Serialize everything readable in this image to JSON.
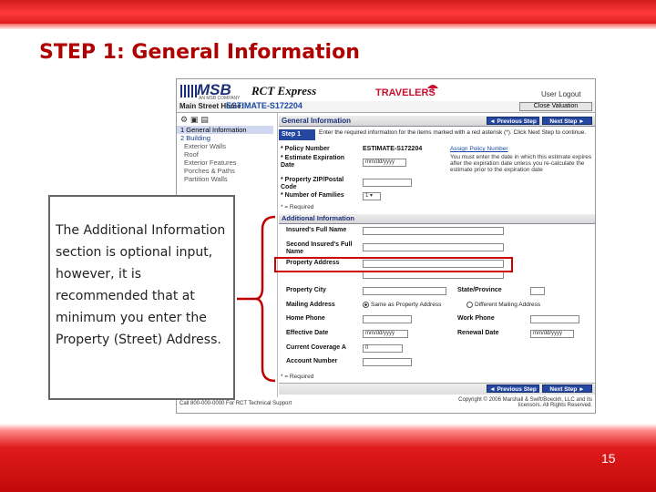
{
  "slide": {
    "title": "STEP 1:  General Information",
    "page_number": "15"
  },
  "app": {
    "msb_logo": "MSB",
    "msb_sub": "AN MSB COMPANY",
    "product": "RCT Express",
    "partner": "TRAVELERS",
    "logout": "User  Logout",
    "home_label": "Main Street Home:",
    "estimate_id": "ESTIMATE-S172204",
    "close_button": "Close Valuation"
  },
  "nav": {
    "items": [
      "1 General Information",
      "2 Building",
      "Exterior Walls",
      "Roof",
      "Exterior Features",
      "Porches & Paths",
      "Partition Walls"
    ]
  },
  "form": {
    "section_title": "General Information",
    "prev_button": "Previous Step",
    "next_button": "Next Step",
    "step_tag": "Step 1",
    "instructions": "Enter the required information for the items marked with a red asterisk (*). Click Next Step to continue.",
    "policy_label": "* Policy Number",
    "policy_value": "ESTIMATE-S172204",
    "assign_link": "Assign Policy Number",
    "expiry_label": "* Estimate Expiration Date",
    "date_placeholder": "mm/dd/yyyy",
    "expiry_note": "You must enter the date in which this estimate expires after the expiration date unless you re-calculate the estimate prior to the expiration date",
    "zip_label": "* Property ZIP/Postal Code",
    "families_label": "* Number of Families",
    "families_value": "1",
    "required_note": "* = Required",
    "addl_title": "Additional Information",
    "insured_name": "Insured's Full Name",
    "second_insured": "Second Insured's Full Name",
    "property_address": "Property Address",
    "property_city": "Property City",
    "state": "State/Province",
    "mailing_address": "Mailing Address",
    "same_as_property": "Same as Property Address",
    "different_mailing": "Different Mailing Address",
    "home_phone": "Home Phone",
    "work_phone": "Work Phone",
    "effective_date": "Effective Date",
    "renewal_date": "Renewal Date",
    "current_coverage": "Current Coverage A",
    "coverage_value": "0",
    "account_number": "Account Number",
    "required_note2": "* = Required",
    "prev_button2": "Previous Step",
    "next_button2": "Next Step"
  },
  "shot_footer": {
    "left": "Call 800-000-0000 For RCT Technical Support",
    "right": "Copyright © 2006 Marshall & Swift/Boeckh, LLC and its licensors. All Rights Reserved."
  },
  "callout": {
    "text": "The Additional Information section is optional input, however, it is recommended that at minimum you enter the Property (Street) Address."
  },
  "colors": {
    "accent_red": "#c00000",
    "nav_blue": "#2547a0",
    "band_red": "#e01b1b"
  }
}
